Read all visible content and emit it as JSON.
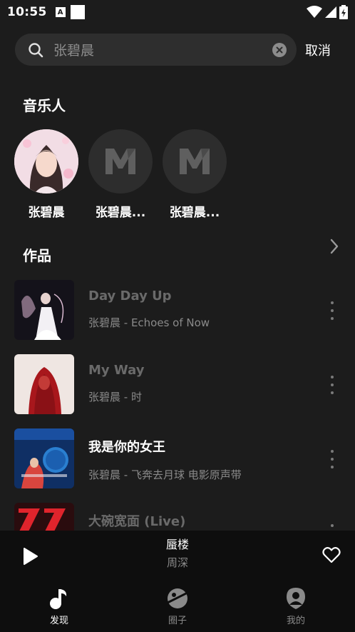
{
  "status": {
    "time": "10:55",
    "a_badge": "A"
  },
  "search": {
    "query": "张碧晨",
    "cancel_label": "取消"
  },
  "artists_section": {
    "title": "音乐人",
    "items": [
      {
        "name": "张碧晨"
      },
      {
        "name": "张碧晨..."
      },
      {
        "name": "张碧晨..."
      }
    ]
  },
  "works_section": {
    "title": "作品",
    "songs": [
      {
        "title": "Day Day Up",
        "subtitle": "张碧晨 - Echoes of Now",
        "dimmed": true
      },
      {
        "title": "My Way",
        "subtitle": "张碧晨 - 时",
        "dimmed": true
      },
      {
        "title": "我是你的女王",
        "subtitle": "张碧晨 - 飞奔去月球 电影原声带",
        "dimmed": false
      },
      {
        "title": "大碗宽面 (Live)",
        "subtitle": "",
        "dimmed": true
      }
    ]
  },
  "player": {
    "title": "蜃楼",
    "artist": "周深"
  },
  "tabs": [
    {
      "label": "发现",
      "icon": "music-note-icon",
      "active": true
    },
    {
      "label": "圈子",
      "icon": "planet-icon",
      "active": false
    },
    {
      "label": "我的",
      "icon": "profile-icon",
      "active": false
    }
  ],
  "colors": {
    "background": "#1c1c1c",
    "search_box": "#2e2e2e",
    "bar": "#0e0e0e",
    "secondary_text": "#8a8a8a"
  }
}
